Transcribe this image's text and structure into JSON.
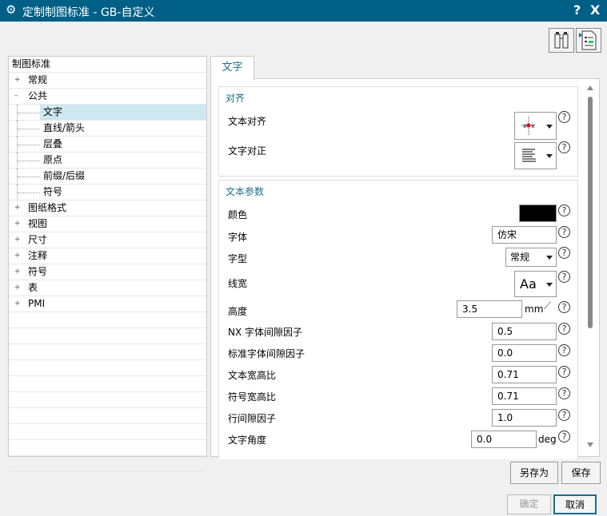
{
  "title": "定制制图标准 - GB-自定义",
  "help_label": "?",
  "close_label": "X",
  "tree": {
    "header": "制图标准",
    "items": [
      {
        "label": "常规",
        "level": 0,
        "expander": "+"
      },
      {
        "label": "公共",
        "level": 0,
        "expander": "-"
      },
      {
        "label": "文字",
        "level": 1,
        "selected": true
      },
      {
        "label": "直线/箭头",
        "level": 1
      },
      {
        "label": "层叠",
        "level": 1
      },
      {
        "label": "原点",
        "level": 1
      },
      {
        "label": "前缀/后缀",
        "level": 1
      },
      {
        "label": "符号",
        "level": 1
      },
      {
        "label": "图纸格式",
        "level": 0,
        "expander": "+"
      },
      {
        "label": "视图",
        "level": 0,
        "expander": "+"
      },
      {
        "label": "尺寸",
        "level": 0,
        "expander": "+"
      },
      {
        "label": "注释",
        "level": 0,
        "expander": "+"
      },
      {
        "label": "符号",
        "level": 0,
        "expander": "+"
      },
      {
        "label": "表",
        "level": 0,
        "expander": "+"
      },
      {
        "label": "PMI",
        "level": 0,
        "expander": "+"
      }
    ]
  },
  "tab": "文字",
  "align": {
    "title": "对齐",
    "text_align": "文本对齐",
    "text_justify": "文字对正"
  },
  "params": {
    "title": "文本参数",
    "color_label": "颜色",
    "color": "#000000",
    "font_label": "字体",
    "font": "仿宋",
    "style_label": "字型",
    "style": "常规",
    "line_width_label": "线宽",
    "line_width": "Aa",
    "height_label": "高度",
    "height": "3.5",
    "height_unit": "mm",
    "nx_gap_label": "NX 字体间隙因子",
    "nx_gap": "0.5",
    "std_gap_label": "标准字体间隙因子",
    "std_gap": "0.0",
    "text_ratio_label": "文本宽高比",
    "text_ratio": "0.71",
    "sym_ratio_label": "符号宽高比",
    "sym_ratio": "0.71",
    "line_gap_label": "行间隙因子",
    "line_gap": "1.0",
    "angle_label": "文字角度",
    "angle": "0.0",
    "angle_unit": "deg"
  },
  "buttons": {
    "save_as": "另存为",
    "save": "保存",
    "ok": "确定",
    "cancel": "取消"
  },
  "help_q": "?"
}
